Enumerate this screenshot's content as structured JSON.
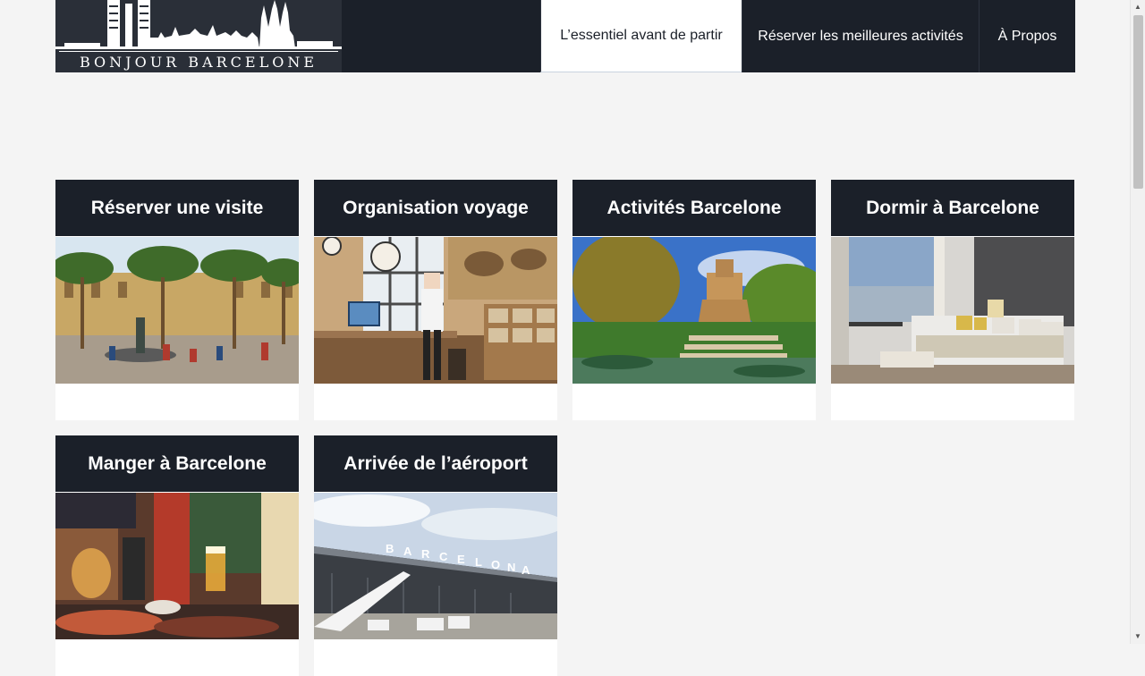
{
  "header": {
    "logo_text": "BONJOUR BARCELONE",
    "nav": [
      {
        "label": "L’essentiel avant de partir",
        "active": true
      },
      {
        "label": "Réserver les meilleures activités",
        "active": false
      },
      {
        "label": "À Propos",
        "active": false
      }
    ]
  },
  "cards": [
    {
      "title": "Réserver une visite",
      "image": "plaza-real-fountain-palms"
    },
    {
      "title": "Organisation voyage",
      "image": "travel-planner-office"
    },
    {
      "title": "Activités Barcelone",
      "image": "parc-ciutadella-cascade"
    },
    {
      "title": "Dormir à Barcelone",
      "image": "hotel-room-bed"
    },
    {
      "title": "Manger à Barcelone",
      "image": "tapas-bar-terrace"
    },
    {
      "title": "Arrivée de l’aéroport",
      "image": "barcelona-airport-terminal"
    }
  ],
  "colors": {
    "header_bg": "#1b2029",
    "card_title_bg": "#1b2029",
    "page_bg": "#f4f4f4"
  }
}
